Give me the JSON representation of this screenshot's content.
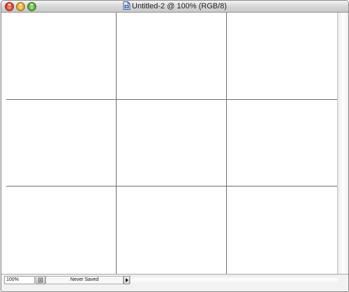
{
  "window": {
    "title": "Untitled-2 @ 100% (RGB/8)",
    "document_icon": "photoshop-document-icon",
    "traffic_lights": {
      "close": "#d33320",
      "minimize": "#e0a114",
      "zoom": "#4ea330"
    }
  },
  "canvas": {
    "background": "#ffffff",
    "guide_color": "#6d6d6d",
    "grid_columns": 3,
    "grid_rows": 3
  },
  "statusbar": {
    "zoom_value": "100%",
    "info_text": "Never Saved",
    "menu_arrow_icon": "triangle-right-icon",
    "status_button_icon": "document-status-icon"
  }
}
